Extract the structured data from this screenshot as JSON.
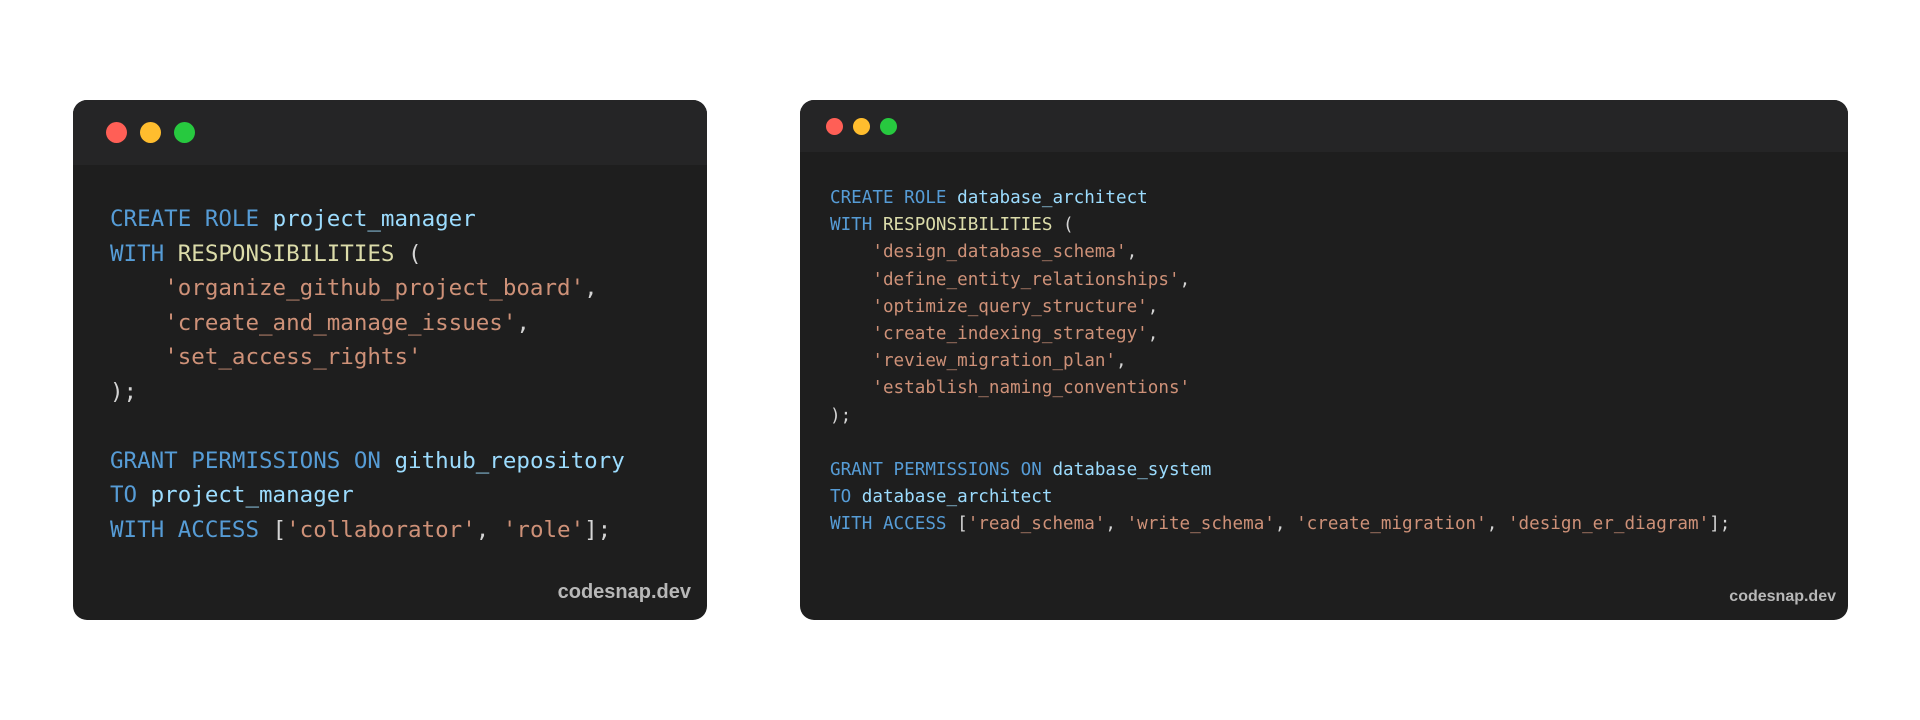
{
  "colors": {
    "background": "#ffffff",
    "window": "#1e1e1e",
    "titlebar": "#252526",
    "red": "#ff5f56",
    "yellow": "#ffbd2e",
    "green": "#27c93f",
    "keyword": "#569cd6",
    "identifier": "#9cdcfe",
    "function": "#dcdcaa",
    "string": "#ce9178",
    "punctuation": "#d4d4d4",
    "watermark": "#b8b8b8"
  },
  "icons": [
    "close-dot-icon",
    "minimize-dot-icon",
    "maximize-dot-icon"
  ],
  "left": {
    "watermark": "codesnap.dev",
    "lines": [
      [
        {
          "t": "kw",
          "v": "CREATE ROLE "
        },
        {
          "t": "id",
          "v": "project_manager"
        }
      ],
      [
        {
          "t": "kw",
          "v": "WITH "
        },
        {
          "t": "fn",
          "v": "RESPONSIBILITIES"
        },
        {
          "t": "pun",
          "v": " ("
        }
      ],
      [
        {
          "t": "pun",
          "v": "    "
        },
        {
          "t": "str",
          "v": "'organize_github_project_board'"
        },
        {
          "t": "pun",
          "v": ","
        }
      ],
      [
        {
          "t": "pun",
          "v": "    "
        },
        {
          "t": "str",
          "v": "'create_and_manage_issues'"
        },
        {
          "t": "pun",
          "v": ","
        }
      ],
      [
        {
          "t": "pun",
          "v": "    "
        },
        {
          "t": "str",
          "v": "'set_access_rights'"
        }
      ],
      [
        {
          "t": "pun",
          "v": ");"
        }
      ],
      [
        {
          "t": "pun",
          "v": ""
        }
      ],
      [
        {
          "t": "kw",
          "v": "GRANT PERMISSIONS ON "
        },
        {
          "t": "id",
          "v": "github_repository"
        }
      ],
      [
        {
          "t": "kw",
          "v": "TO "
        },
        {
          "t": "id",
          "v": "project_manager"
        }
      ],
      [
        {
          "t": "kw",
          "v": "WITH ACCESS "
        },
        {
          "t": "pun",
          "v": "["
        },
        {
          "t": "str",
          "v": "'collaborator'"
        },
        {
          "t": "pun",
          "v": ", "
        },
        {
          "t": "str",
          "v": "'role'"
        },
        {
          "t": "pun",
          "v": "];"
        }
      ]
    ]
  },
  "right": {
    "watermark": "codesnap.dev",
    "lines": [
      [
        {
          "t": "kw",
          "v": "CREATE ROLE "
        },
        {
          "t": "id",
          "v": "database_architect"
        }
      ],
      [
        {
          "t": "kw",
          "v": "WITH "
        },
        {
          "t": "fn",
          "v": "RESPONSIBILITIES"
        },
        {
          "t": "pun",
          "v": " ("
        }
      ],
      [
        {
          "t": "pun",
          "v": "    "
        },
        {
          "t": "str",
          "v": "'design_database_schema'"
        },
        {
          "t": "pun",
          "v": ","
        }
      ],
      [
        {
          "t": "pun",
          "v": "    "
        },
        {
          "t": "str",
          "v": "'define_entity_relationships'"
        },
        {
          "t": "pun",
          "v": ","
        }
      ],
      [
        {
          "t": "pun",
          "v": "    "
        },
        {
          "t": "str",
          "v": "'optimize_query_structure'"
        },
        {
          "t": "pun",
          "v": ","
        }
      ],
      [
        {
          "t": "pun",
          "v": "    "
        },
        {
          "t": "str",
          "v": "'create_indexing_strategy'"
        },
        {
          "t": "pun",
          "v": ","
        }
      ],
      [
        {
          "t": "pun",
          "v": "    "
        },
        {
          "t": "str",
          "v": "'review_migration_plan'"
        },
        {
          "t": "pun",
          "v": ","
        }
      ],
      [
        {
          "t": "pun",
          "v": "    "
        },
        {
          "t": "str",
          "v": "'establish_naming_conventions'"
        }
      ],
      [
        {
          "t": "pun",
          "v": ");"
        }
      ],
      [
        {
          "t": "pun",
          "v": ""
        }
      ],
      [
        {
          "t": "kw",
          "v": "GRANT PERMISSIONS ON "
        },
        {
          "t": "id",
          "v": "database_system"
        }
      ],
      [
        {
          "t": "kw",
          "v": "TO "
        },
        {
          "t": "id",
          "v": "database_architect"
        }
      ],
      [
        {
          "t": "kw",
          "v": "WITH ACCESS "
        },
        {
          "t": "pun",
          "v": "["
        },
        {
          "t": "str",
          "v": "'read_schema'"
        },
        {
          "t": "pun",
          "v": ", "
        },
        {
          "t": "str",
          "v": "'write_schema'"
        },
        {
          "t": "pun",
          "v": ", "
        },
        {
          "t": "str",
          "v": "'create_migration'"
        },
        {
          "t": "pun",
          "v": ", "
        },
        {
          "t": "str",
          "v": "'design_er_diagram'"
        },
        {
          "t": "pun",
          "v": "];"
        }
      ]
    ]
  }
}
